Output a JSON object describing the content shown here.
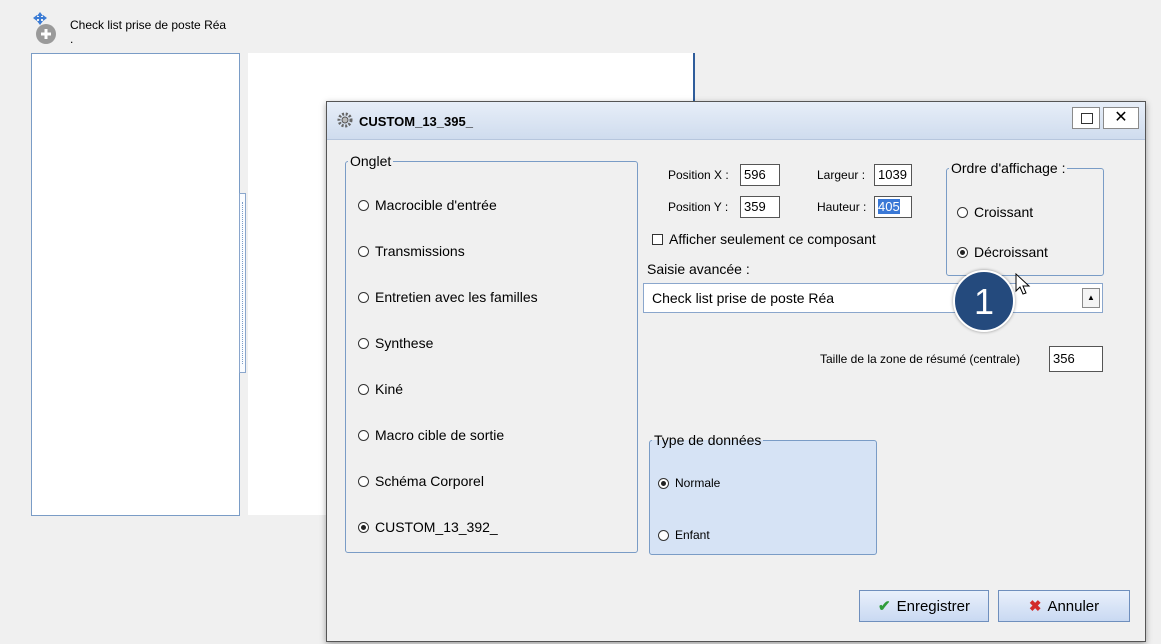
{
  "background": {
    "title": "Check list prise de poste Réa",
    "dot": "."
  },
  "dialog": {
    "title": "CUSTOM_13_395_",
    "close_glyph": "✕",
    "onglet": {
      "legend": "Onglet",
      "items": [
        {
          "label": "Macrocible d'entrée",
          "selected": false
        },
        {
          "label": "Transmissions",
          "selected": false
        },
        {
          "label": "Entretien avec les familles",
          "selected": false
        },
        {
          "label": "Synthese",
          "selected": false
        },
        {
          "label": "Kiné",
          "selected": false
        },
        {
          "label": "Macro cible de sortie",
          "selected": false
        },
        {
          "label": "Schéma Corporel",
          "selected": false
        },
        {
          "label": "CUSTOM_13_392_",
          "selected": true
        }
      ]
    },
    "position": {
      "x_label": "Position X :",
      "x_value": "596",
      "y_label": "Position Y :",
      "y_value": "359",
      "largeur_label": "Largeur :",
      "largeur_value": "1039",
      "hauteur_label": "Hauteur :",
      "hauteur_value": "405"
    },
    "ordre": {
      "legend": "Ordre d'affichage :",
      "croissant": "Croissant",
      "decroissant": "Décroissant",
      "selected": "decroissant"
    },
    "afficher_label": "Afficher seulement ce composant",
    "saisie_label": "Saisie avancée :",
    "saisie_value": "Check list prise de poste Réa",
    "taille_label": "Taille de la zone de résumé (centrale)",
    "taille_value": "356",
    "type": {
      "legend": "Type de données",
      "normale": "Normale",
      "enfant": "Enfant",
      "selected": "normale"
    },
    "buttons": {
      "save": "Enregistrer",
      "cancel": "Annuler"
    },
    "badge": "1",
    "colors": {
      "accent": "#244a7d",
      "save_icon": "#2e9c3a",
      "cancel_icon": "#d22b2b"
    }
  }
}
